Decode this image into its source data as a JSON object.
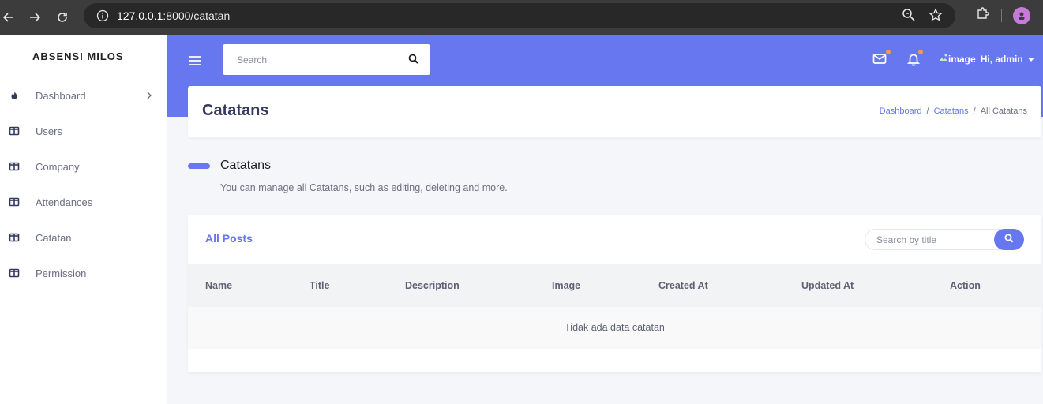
{
  "browser": {
    "url_host": "127.0.0.1",
    "url_rest": ":8000/catatan"
  },
  "sidebar": {
    "brand": "ABSENSI MILOS",
    "items": [
      {
        "label": "Dashboard",
        "icon": "fire-icon"
      },
      {
        "label": "Users",
        "icon": "columns-icon"
      },
      {
        "label": "Company",
        "icon": "columns-icon"
      },
      {
        "label": "Attendances",
        "icon": "columns-icon"
      },
      {
        "label": "Catatan",
        "icon": "columns-icon"
      },
      {
        "label": "Permission",
        "icon": "columns-icon"
      }
    ]
  },
  "topbar": {
    "search_placeholder": "Search",
    "user_image_alt": "image",
    "user_greeting": "Hi, admin"
  },
  "header": {
    "title": "Catatans",
    "breadcrumb": [
      "Dashboard",
      "Catatans",
      "All Catatans"
    ]
  },
  "section": {
    "title": "Catatans",
    "lead": "You can manage all Catatans, such as editing, deleting and more."
  },
  "card": {
    "title": "All Posts",
    "search_placeholder": "Search by title",
    "columns": [
      "Name",
      "Title",
      "Description",
      "Image",
      "Created At",
      "Updated At",
      "Action"
    ],
    "empty_message": "Tidak ada data catatan"
  },
  "colors": {
    "primary": "#6777ef",
    "badge": "#fd9644"
  }
}
